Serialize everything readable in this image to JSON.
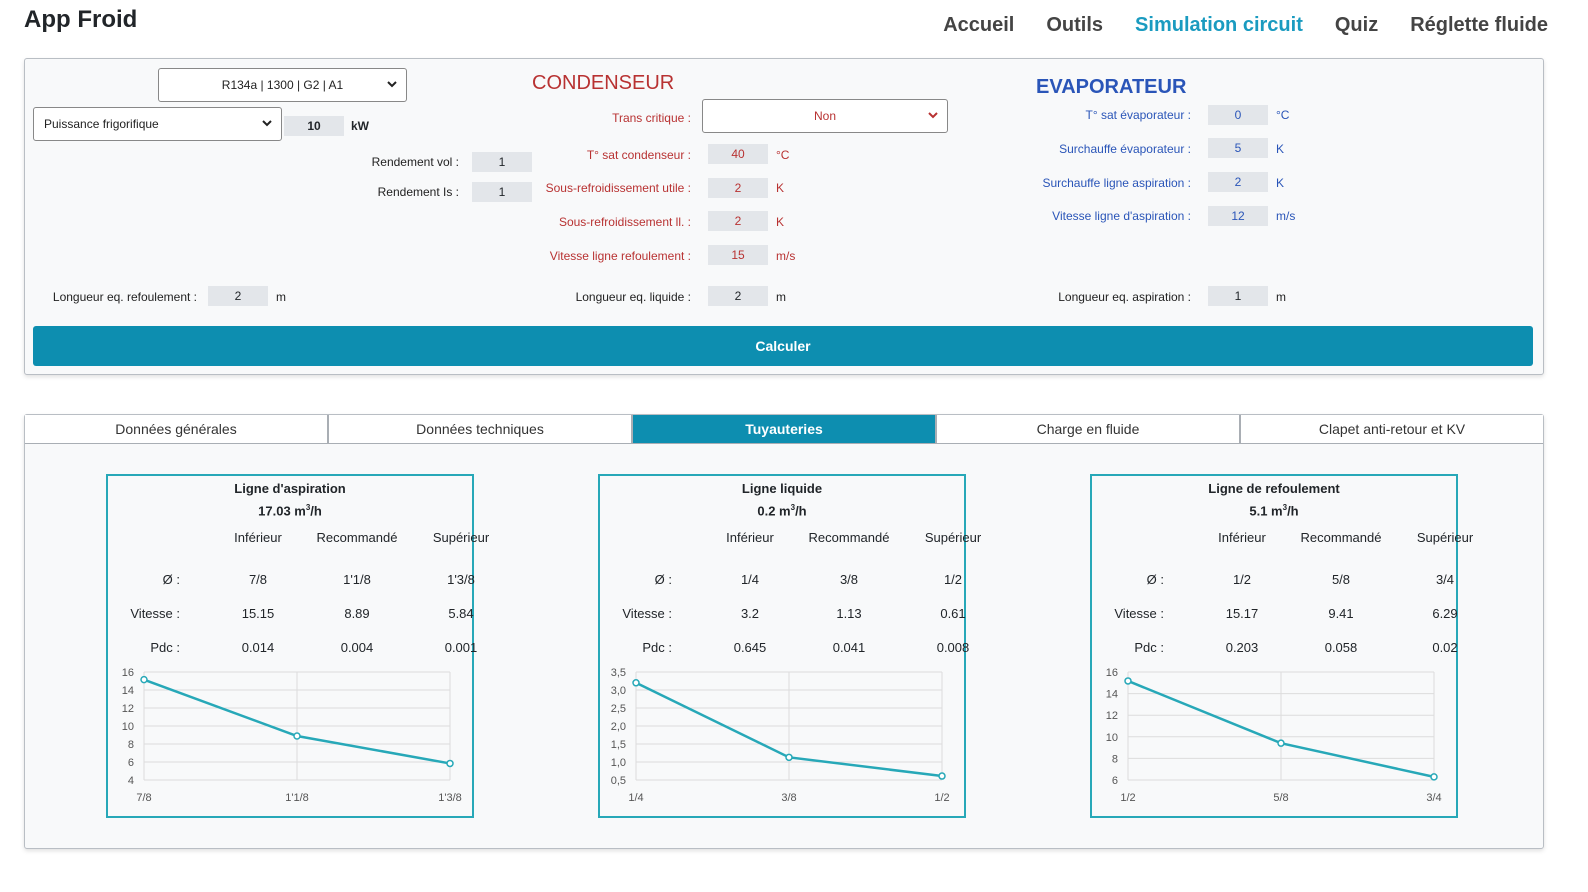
{
  "app": {
    "title": "App Froid"
  },
  "nav": {
    "items": [
      "Accueil",
      "Outils",
      "Simulation circuit",
      "Quiz",
      "Réglette fluide"
    ],
    "active": 2
  },
  "form": {
    "fluid_select": "R134a | 1300 | G2 | A1",
    "power_select": "Puissance frigorifique",
    "power_value": "10",
    "power_unit": "kW",
    "rend_vol_label": "Rendement vol :",
    "rend_vol_value": "1",
    "rend_is_label": "Rendement Is :",
    "rend_is_value": "1",
    "long_ref_label": "Longueur eq. refoulement :",
    "long_ref_value": "2",
    "long_ref_unit": "m",
    "condenseur": {
      "title": "CONDENSEUR",
      "trans_label": "Trans critique :",
      "trans_value": "Non",
      "tsat_label": "T° sat condenseur :",
      "tsat_value": "40",
      "tsat_unit": "°C",
      "sr_utile_label": "Sous-refroidissement utile :",
      "sr_utile_value": "2",
      "sr_utile_unit": "K",
      "sr_ll_label": "Sous-refroidissement ll. :",
      "sr_ll_value": "2",
      "sr_ll_unit": "K",
      "vit_ref_label": "Vitesse ligne refoulement :",
      "vit_ref_value": "15",
      "vit_ref_unit": "m/s",
      "long_liq_label": "Longueur eq. liquide :",
      "long_liq_value": "2",
      "long_liq_unit": "m"
    },
    "evaporateur": {
      "title": "EVAPORATEUR",
      "tsat_label": "T° sat évaporateur :",
      "tsat_value": "0",
      "tsat_unit": "°C",
      "surch_label": "Surchauffe évaporateur :",
      "surch_value": "5",
      "surch_unit": "K",
      "surch_asp_label": "Surchauffe ligne aspiration :",
      "surch_asp_value": "2",
      "surch_asp_unit": "K",
      "vit_asp_label": "Vitesse ligne d'aspiration :",
      "vit_asp_value": "12",
      "vit_asp_unit": "m/s",
      "long_asp_label": "Longueur eq. aspiration :",
      "long_asp_value": "1",
      "long_asp_unit": "m"
    },
    "calc_button": "Calculer"
  },
  "tabs": {
    "items": [
      "Données générales",
      "Données techniques",
      "Tuyauteries",
      "Charge en fluide",
      "Clapet anti-retour et KV"
    ],
    "active": 2
  },
  "cards": [
    {
      "title": "Ligne d'aspiration",
      "flow": "17.03 m",
      "flow_unit": "/h",
      "headers": [
        "Inférieur",
        "Recommandé",
        "Supérieur"
      ],
      "row_labels": [
        "Ø :",
        "Vitesse :",
        "Pdc :"
      ],
      "diam": [
        "7/8",
        "1'1/8",
        "1'3/8"
      ],
      "vitesse": [
        "15.15",
        "8.89",
        "5.84"
      ],
      "pdc": [
        "0.014",
        "0.004",
        "0.001"
      ]
    },
    {
      "title": "Ligne liquide",
      "flow": "0.2 m",
      "flow_unit": "/h",
      "headers": [
        "Inférieur",
        "Recommandé",
        "Supérieur"
      ],
      "row_labels": [
        "Ø :",
        "Vitesse :",
        "Pdc :"
      ],
      "diam": [
        "1/4",
        "3/8",
        "1/2"
      ],
      "vitesse": [
        "3.2",
        "1.13",
        "0.61"
      ],
      "pdc": [
        "0.645",
        "0.041",
        "0.008"
      ]
    },
    {
      "title": "Ligne de refoulement",
      "flow": "5.1 m",
      "flow_unit": "/h",
      "headers": [
        "Inférieur",
        "Recommandé",
        "Supérieur"
      ],
      "row_labels": [
        "Ø :",
        "Vitesse :",
        "Pdc :"
      ],
      "diam": [
        "1/2",
        "5/8",
        "3/4"
      ],
      "vitesse": [
        "15.17",
        "9.41",
        "6.29"
      ],
      "pdc": [
        "0.203",
        "0.058",
        "0.02"
      ]
    }
  ],
  "chart_data": [
    {
      "type": "line",
      "categories": [
        "7/8",
        "1'1/8",
        "1'3/8"
      ],
      "values": [
        15.15,
        8.89,
        5.84
      ],
      "ylim": [
        4,
        16
      ],
      "yticks": [
        "4",
        "6",
        "8",
        "10",
        "12",
        "14",
        "16"
      ],
      "grid": true,
      "color": "#27a8b8"
    },
    {
      "type": "line",
      "categories": [
        "1/4",
        "3/8",
        "1/2"
      ],
      "values": [
        3.2,
        1.13,
        0.61
      ],
      "ylim": [
        0.5,
        3.5
      ],
      "yticks": [
        "0,5",
        "1,0",
        "1,5",
        "2,0",
        "2,5",
        "3,0",
        "3,5"
      ],
      "grid": true,
      "color": "#27a8b8"
    },
    {
      "type": "line",
      "categories": [
        "1/2",
        "5/8",
        "3/4"
      ],
      "values": [
        15.17,
        9.41,
        6.29
      ],
      "ylim": [
        6,
        16
      ],
      "yticks": [
        "6",
        "8",
        "10",
        "12",
        "14",
        "16"
      ],
      "grid": true,
      "color": "#27a8b8"
    }
  ]
}
